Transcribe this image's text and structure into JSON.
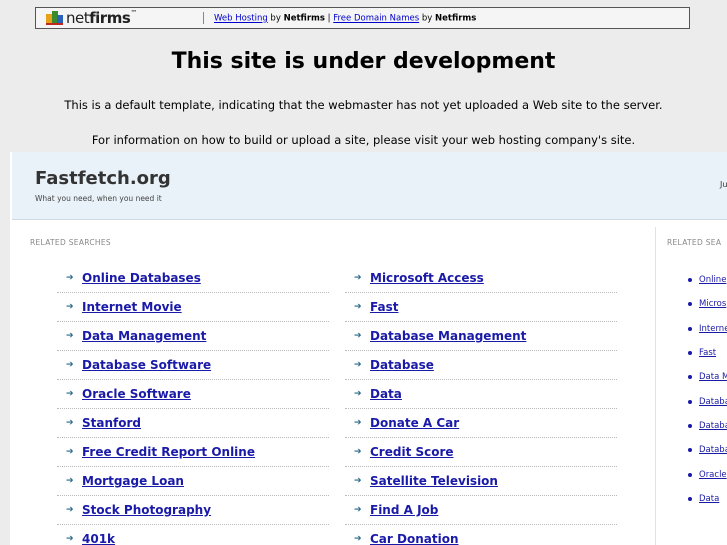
{
  "netfirms_bar": {
    "logo_text_light": "net",
    "logo_text_bold": "firms",
    "logo_tm": "™",
    "link_web_hosting": "Web Hosting",
    "by1": " by ",
    "brand1": "Netfirms",
    "sep": " | ",
    "link_domain_names": "Free Domain Names",
    "by2": " by ",
    "brand2": "Netfirms"
  },
  "headline": "This site is under development",
  "line1": "This is a default template, indicating that the webmaster has not yet uploaded a Web site to the server.",
  "line2": "For information on how to build or upload a site, please visit your web hosting company's site.",
  "parked": {
    "site_name": "Fastfetch.org",
    "tagline": "What you need, when you need it",
    "head_right": "Ju",
    "related_label": "RELATED SEARCHES",
    "related_label_side": "RELATED SEA",
    "col1": [
      "Online Databases",
      "Internet Movie",
      "Data Management",
      "Database Software",
      "Oracle Software",
      "Stanford",
      "Free Credit Report Online",
      "Mortgage Loan",
      "Stock Photography",
      "401k"
    ],
    "col2": [
      "Microsoft Access",
      "Fast",
      "Database Management",
      "Database",
      "Data",
      "Donate A Car",
      "Credit Score",
      "Satellite Television",
      "Find A Job",
      "Car Donation"
    ],
    "side": [
      "Online",
      "Micros",
      "Interne",
      "Fast",
      "Data M",
      "Databa",
      "Databa",
      "Databa",
      "Oracle",
      "Data"
    ]
  },
  "colors": {
    "link": "#1a1aa8",
    "header_bg": "#e9f2f8",
    "page_bg": "#ececec"
  }
}
